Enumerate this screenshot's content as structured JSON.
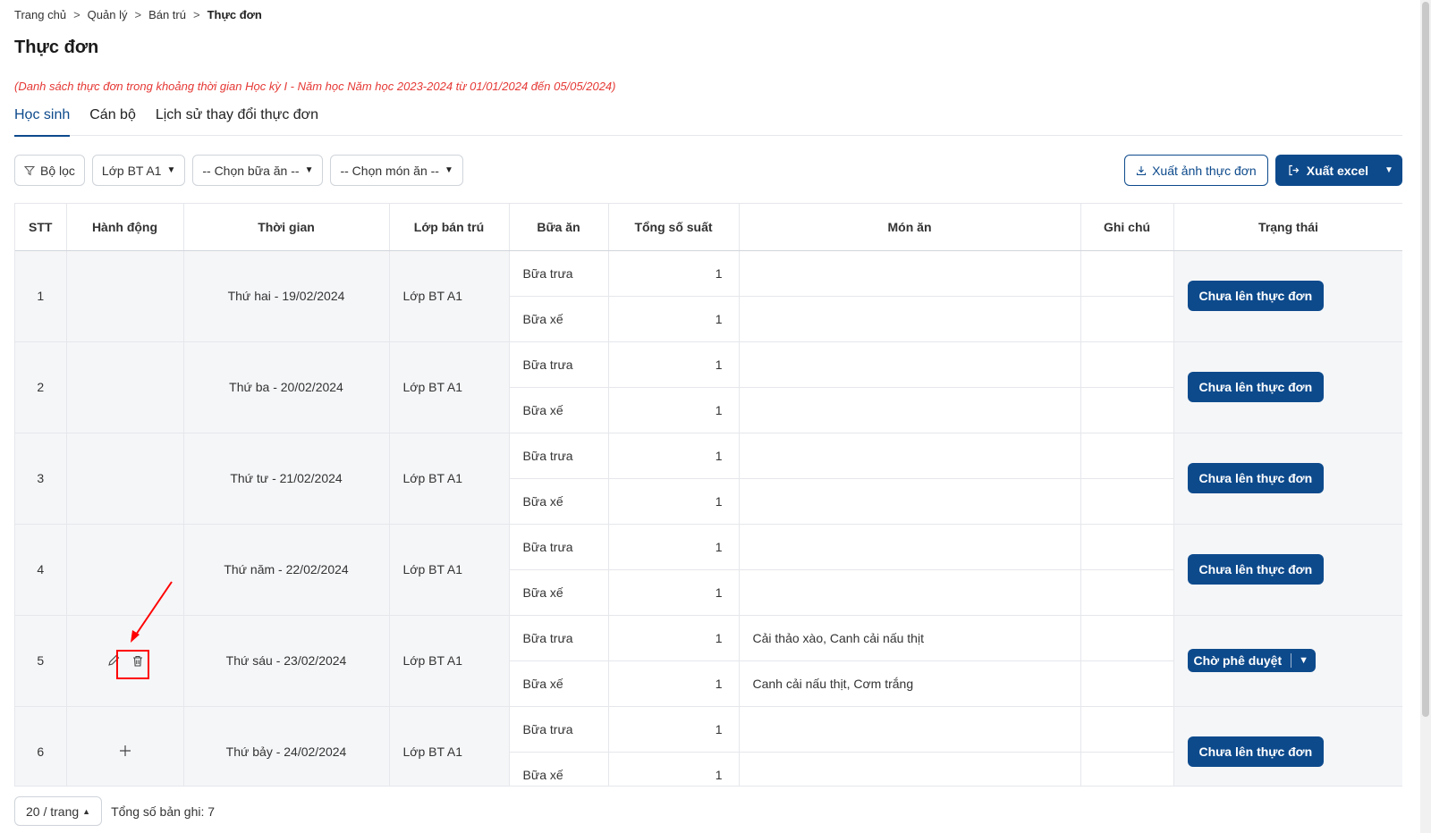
{
  "breadcrumb": {
    "items": [
      "Trang chủ",
      "Quản lý",
      "Bán trú"
    ],
    "current": "Thực đơn",
    "sep": ">"
  },
  "page": {
    "title": "Thực đơn",
    "note": "(Danh sách thực đơn trong khoảng thời gian Học kỳ I - Năm học Năm học 2023-2024 từ 01/01/2024 đến 05/05/2024)"
  },
  "tabs": [
    {
      "label": "Học sinh",
      "active": true
    },
    {
      "label": "Cán bộ",
      "active": false
    },
    {
      "label": "Lịch sử thay đổi thực đơn",
      "active": false
    }
  ],
  "filters": {
    "filter_label": "Bộ lọc",
    "class_value": "Lớp BT A1",
    "meal_placeholder": "-- Chọn bữa ăn --",
    "dish_placeholder": "-- Chọn món ăn --"
  },
  "actions": {
    "export_image": "Xuất ảnh thực đơn",
    "export_excel": "Xuất excel"
  },
  "table": {
    "headers": {
      "stt": "STT",
      "action": "Hành động",
      "time": "Thời gian",
      "class": "Lớp bán trú",
      "meal": "Bữa ăn",
      "total": "Tổng số suất",
      "dish": "Món ăn",
      "note": "Ghi chú",
      "status": "Trạng thái"
    },
    "rows": [
      {
        "stt": "1",
        "time": "Thứ hai - 19/02/2024",
        "class": "Lớp BT A1",
        "meal1": "Bữa trưa",
        "total1": "1",
        "dish1": "",
        "meal2": "Bữa xế",
        "total2": "1",
        "dish2": "",
        "status": "Chưa lên thực đơn"
      },
      {
        "stt": "2",
        "time": "Thứ ba - 20/02/2024",
        "class": "Lớp BT A1",
        "meal1": "Bữa trưa",
        "total1": "1",
        "dish1": "",
        "meal2": "Bữa xế",
        "total2": "1",
        "dish2": "",
        "status": "Chưa lên thực đơn"
      },
      {
        "stt": "3",
        "time": "Thứ tư - 21/02/2024",
        "class": "Lớp BT A1",
        "meal1": "Bữa trưa",
        "total1": "1",
        "dish1": "",
        "meal2": "Bữa xế",
        "total2": "1",
        "dish2": "",
        "status": "Chưa lên thực đơn"
      },
      {
        "stt": "4",
        "time": "Thứ năm - 22/02/2024",
        "class": "Lớp BT A1",
        "meal1": "Bữa trưa",
        "total1": "1",
        "dish1": "",
        "meal2": "Bữa xế",
        "total2": "1",
        "dish2": "",
        "status": "Chưa lên thực đơn"
      },
      {
        "stt": "5",
        "time": "Thứ sáu - 23/02/2024",
        "class": "Lớp BT A1",
        "meal1": "Bữa trưa",
        "total1": "1",
        "dish1": "Cải thảo xào, Canh cải nấu thịt",
        "meal2": "Bữa xế",
        "total2": "1",
        "dish2": "Canh cải nấu thịt, Cơm trắng",
        "status": "Chờ phê duyệt"
      },
      {
        "stt": "6",
        "time": "Thứ bảy - 24/02/2024",
        "class": "Lớp BT A1",
        "meal1": "Bữa trưa",
        "total1": "1",
        "dish1": "",
        "meal2": "Bữa xế",
        "total2": "1",
        "dish2": "",
        "status": "Chưa lên thực đơn"
      }
    ]
  },
  "pager": {
    "page_size": "20 / trang",
    "total": "Tổng số bản ghi: 7"
  },
  "colors": {
    "primary": "#0d4a8c",
    "note": "#e53935",
    "annotation": "#ff0000"
  }
}
